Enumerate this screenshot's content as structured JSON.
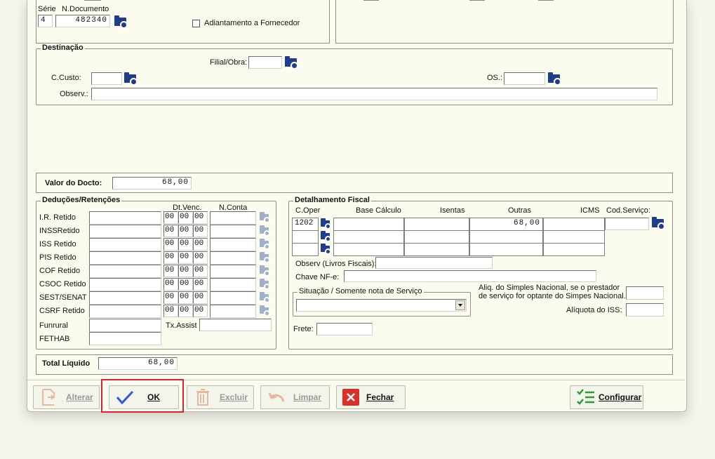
{
  "top_fields": {
    "serie_label": "Série",
    "serie_value": "4",
    "doc_label": "N.Documento",
    "doc_value": "482340",
    "adiantamento_label": "Adiantamento a Fornecedor"
  },
  "destinacao": {
    "title": "Destinação",
    "filial_label": "Filial/Obra:",
    "ccusto_label": "C.Custo:",
    "os_label": "OS.:",
    "observ_label": "Observ.:"
  },
  "valor_docto": {
    "label": "Valor do Docto:",
    "value": "68,00"
  },
  "deducoes": {
    "title": "Deduções/Retenções",
    "dt_venc_header": "Dt.Venc.",
    "nconta_header": "N.Conta",
    "rows": [
      {
        "label": "I.R. Retido",
        "d": "00",
        "m": "00",
        "y": "00"
      },
      {
        "label": "INSSRetido",
        "d": "00",
        "m": "00",
        "y": "00"
      },
      {
        "label": "ISS Retido",
        "d": "00",
        "m": "00",
        "y": "00"
      },
      {
        "label": "PIS Retido",
        "d": "00",
        "m": "00",
        "y": "00"
      },
      {
        "label": "COF Retido",
        "d": "00",
        "m": "00",
        "y": "00"
      },
      {
        "label": "CSOC Retido",
        "d": "00",
        "m": "00",
        "y": "00"
      },
      {
        "label": "SEST/SENAT",
        "d": "00",
        "m": "00",
        "y": "00"
      },
      {
        "label": "CSRF Retido",
        "d": "00",
        "m": "00",
        "y": "00"
      }
    ],
    "funrural_label": "Funrural",
    "fethab_label": "FETHAB",
    "tx_assist_label": "Tx.Assist"
  },
  "fiscal": {
    "title": "Detalhamento Fiscal",
    "headers": [
      "C.Oper",
      "Base Cálculo",
      "Isentas",
      "Outras",
      "ICMS",
      "Cod.Serviço:"
    ],
    "row1": {
      "coper": "1202",
      "outras": "68,00"
    },
    "observ_label": "Observ (Livros Fiscais):",
    "chave_label": "Chave NF-e:",
    "situacao_label": "Situação / Somente nota de Serviço",
    "aliq_simples_label_1": "Aliq. do Simples Nacional, se o prestador",
    "aliq_simples_label_2": "de serviço for optante do Simpes Nacional.",
    "aliq_iss_label": "Alíquota do ISS:",
    "frete_label": "Frete:"
  },
  "total": {
    "label": "Total Líquido",
    "value": "68,00"
  },
  "buttons": {
    "alterar": "Alterar",
    "ok": "OK",
    "excluir": "Excluir",
    "limpar": "Limpar",
    "fechar": "Fechar",
    "configurar": "Configurar"
  },
  "colors": {
    "highlight": "#d9232e",
    "ok_check": "#2b5ad6",
    "close_red": "#d8302a",
    "config_green": "#2e9b3a"
  }
}
